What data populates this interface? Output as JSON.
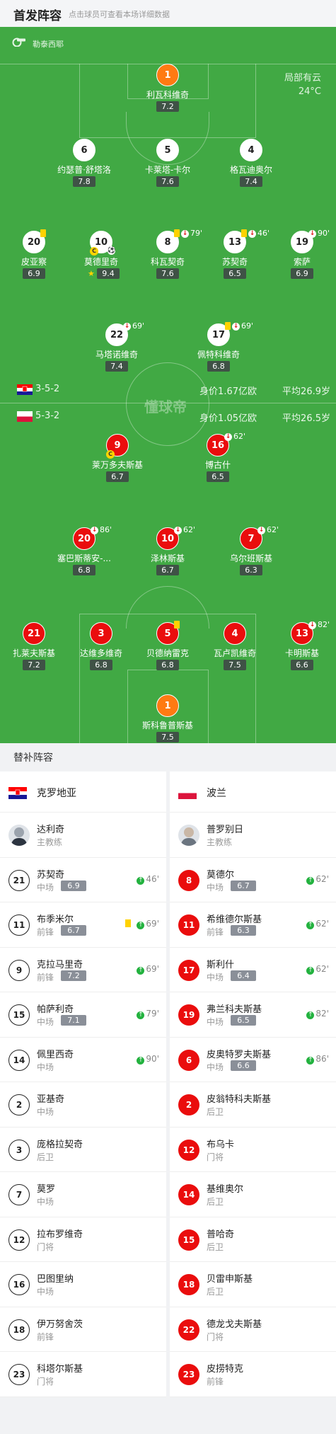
{
  "header": {
    "title": "首发阵容",
    "hint": "点击球员可查看本场详细数据"
  },
  "match": {
    "referee": "勒泰西耶",
    "weather": "局部有云",
    "temperature": "24°C",
    "watermark": "懂球帝"
  },
  "home": {
    "name": "克罗地亚",
    "formation": "3-5-2",
    "value": "身价1.67亿欧",
    "avg_age": "平均26.9岁",
    "flag_colors": [
      "#ff0000",
      "#ffffff",
      "#171796"
    ]
  },
  "away": {
    "name": "波兰",
    "formation": "5-3-2",
    "value": "身价1.05亿欧",
    "avg_age": "平均26.5岁",
    "flag_colors": [
      "#ffffff",
      "#dc143c"
    ]
  },
  "home_players": [
    {
      "num": "1",
      "name": "利瓦科维奇",
      "rating": "7.2"
    },
    {
      "num": "6",
      "name": "约瑟普·舒塔洛",
      "rating": "7.8"
    },
    {
      "num": "5",
      "name": "卡莱塔-卡尔",
      "rating": "7.6"
    },
    {
      "num": "4",
      "name": "格瓦迪奥尔",
      "rating": "7.4"
    },
    {
      "num": "20",
      "name": "皮亚察",
      "rating": "6.9"
    },
    {
      "num": "10",
      "name": "莫德里奇",
      "rating": "9.4"
    },
    {
      "num": "8",
      "name": "科瓦契奇",
      "rating": "7.6",
      "sub_min": "79'"
    },
    {
      "num": "13",
      "name": "苏契奇",
      "rating": "6.5",
      "sub_min": "46'"
    },
    {
      "num": "19",
      "name": "索萨",
      "rating": "6.9",
      "sub_min": "90'"
    },
    {
      "num": "22",
      "name": "马塔诺维奇",
      "rating": "7.4",
      "sub_min": "69'"
    },
    {
      "num": "17",
      "name": "佩特科维奇",
      "rating": "6.8",
      "sub_min": "69'"
    }
  ],
  "away_players": [
    {
      "num": "9",
      "name": "莱万多夫斯基",
      "rating": "6.7"
    },
    {
      "num": "16",
      "name": "博古什",
      "rating": "6.5",
      "sub_min": "62'"
    },
    {
      "num": "20",
      "name": "塞巴斯蒂安-...",
      "rating": "6.8",
      "sub_min": "86'"
    },
    {
      "num": "10",
      "name": "泽林斯基",
      "rating": "6.7",
      "sub_min": "62'"
    },
    {
      "num": "7",
      "name": "乌尔班斯基",
      "rating": "6.3",
      "sub_min": "62'"
    },
    {
      "num": "21",
      "name": "扎莱夫斯基",
      "rating": "7.2"
    },
    {
      "num": "3",
      "name": "达维多维奇",
      "rating": "6.8"
    },
    {
      "num": "5",
      "name": "贝德纳雷克",
      "rating": "6.8"
    },
    {
      "num": "4",
      "name": "瓦卢凯维奇",
      "rating": "7.5"
    },
    {
      "num": "13",
      "name": "卡明斯基",
      "rating": "6.6",
      "sub_min": "82'"
    },
    {
      "num": "1",
      "name": "斯科鲁普斯基",
      "rating": "7.5"
    }
  ],
  "subs": {
    "title": "替补阵容",
    "home_coach": {
      "name": "达利奇",
      "role": "主教练"
    },
    "away_coach": {
      "name": "普罗别日",
      "role": "主教练"
    },
    "home": [
      {
        "num": "21",
        "name": "苏契奇",
        "pos": "中场",
        "rating": "6.9",
        "min": "46'"
      },
      {
        "num": "11",
        "name": "布季米尔",
        "pos": "前锋",
        "rating": "6.7",
        "min": "69'"
      },
      {
        "num": "9",
        "name": "克拉马里奇",
        "pos": "前锋",
        "rating": "7.2",
        "min": "69'"
      },
      {
        "num": "15",
        "name": "帕萨利奇",
        "pos": "中场",
        "rating": "7.1",
        "min": "79'"
      },
      {
        "num": "14",
        "name": "佩里西奇",
        "pos": "中场",
        "rating": "",
        "min": "90'"
      },
      {
        "num": "2",
        "name": "亚基奇",
        "pos": "中场",
        "rating": "",
        "min": ""
      },
      {
        "num": "3",
        "name": "庞格拉契奇",
        "pos": "后卫",
        "rating": "",
        "min": ""
      },
      {
        "num": "7",
        "name": "莫罗",
        "pos": "中场",
        "rating": "",
        "min": ""
      },
      {
        "num": "12",
        "name": "拉布罗维奇",
        "pos": "门将",
        "rating": "",
        "min": ""
      },
      {
        "num": "16",
        "name": "巴图里纳",
        "pos": "中场",
        "rating": "",
        "min": ""
      },
      {
        "num": "18",
        "name": "伊万努舍茨",
        "pos": "前锋",
        "rating": "",
        "min": ""
      },
      {
        "num": "23",
        "name": "科塔尔斯基",
        "pos": "门将",
        "rating": "",
        "min": ""
      }
    ],
    "away": [
      {
        "num": "8",
        "name": "莫德尔",
        "pos": "中场",
        "rating": "6.7",
        "min": "62'"
      },
      {
        "num": "11",
        "name": "希维德尔斯基",
        "pos": "前锋",
        "rating": "6.3",
        "min": "62'"
      },
      {
        "num": "17",
        "name": "斯利什",
        "pos": "中场",
        "rating": "6.4",
        "min": "62'"
      },
      {
        "num": "19",
        "name": "弗兰科夫斯基",
        "pos": "中场",
        "rating": "6.5",
        "min": "82'"
      },
      {
        "num": "6",
        "name": "皮奥特罗夫斯基",
        "pos": "中场",
        "rating": "6.6",
        "min": "86'"
      },
      {
        "num": "2",
        "name": "皮翁特科夫斯基",
        "pos": "后卫",
        "rating": "",
        "min": ""
      },
      {
        "num": "12",
        "name": "布乌卡",
        "pos": "门将",
        "rating": "",
        "min": ""
      },
      {
        "num": "14",
        "name": "基维奥尔",
        "pos": "后卫",
        "rating": "",
        "min": ""
      },
      {
        "num": "15",
        "name": "普哈奇",
        "pos": "后卫",
        "rating": "",
        "min": ""
      },
      {
        "num": "18",
        "name": "贝雷申斯基",
        "pos": "后卫",
        "rating": "",
        "min": ""
      },
      {
        "num": "22",
        "name": "德龙戈夫斯基",
        "pos": "门将",
        "rating": "",
        "min": ""
      },
      {
        "num": "23",
        "name": "皮捞特克",
        "pos": "前锋",
        "rating": "",
        "min": ""
      }
    ]
  }
}
